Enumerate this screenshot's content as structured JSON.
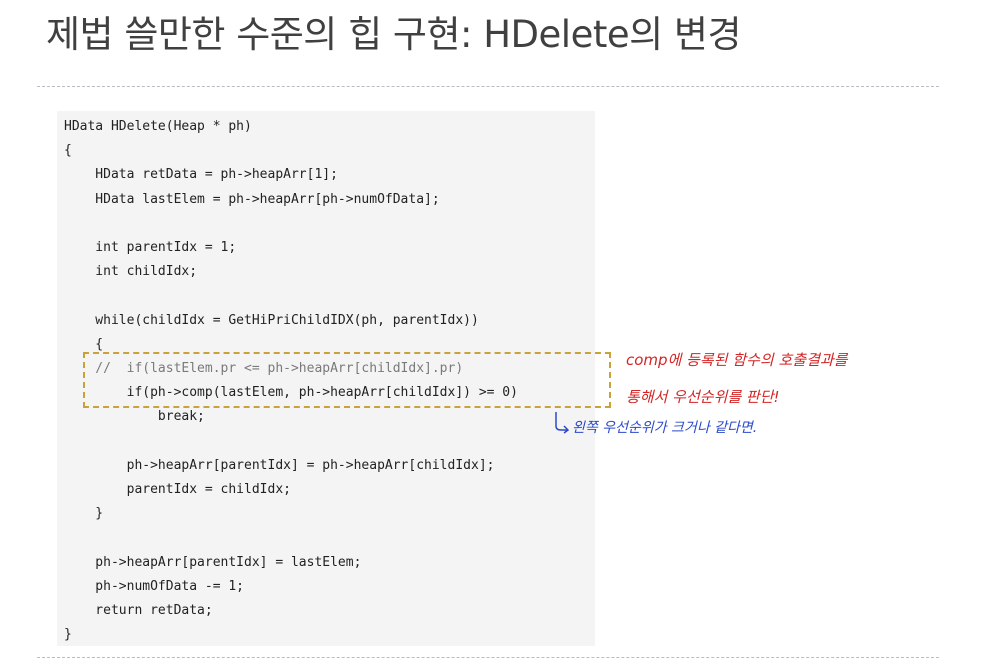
{
  "slide": {
    "title": "제법 쓸만한 수준의 힙 구현: HDelete의 변경"
  },
  "code": {
    "lines": [
      "HData HDelete(Heap * ph)",
      "{",
      "    HData retData = ph->heapArr[1];",
      "    HData lastElem = ph->heapArr[ph->numOfData];",
      "",
      "    int parentIdx = 1;",
      "    int childIdx;",
      "",
      "    while(childIdx = GetHiPriChildIDX(ph, parentIdx))",
      "    {",
      "    //  if(lastElem.pr <= ph->heapArr[childIdx].pr)",
      "        if(ph->comp(lastElem, ph->heapArr[childIdx]) >= 0)",
      "            break;",
      "",
      "        ph->heapArr[parentIdx] = ph->heapArr[childIdx];",
      "        parentIdx = childIdx;",
      "    }",
      "",
      "    ph->heapArr[parentIdx] = lastElem;",
      "    ph->numOfData -= 1;",
      "    return retData;",
      "}"
    ]
  },
  "annotations": {
    "line1": "comp에 등록된 함수의 호출결과를",
    "line2": "통해서 우선순위를 판단!",
    "handwritten": "왼쪽 우선순위가 크거나 같다면."
  },
  "colors": {
    "title": "#404040",
    "annotation": "#d42525",
    "highlight_border": "#c9a33a",
    "handwritten": "#2c49c9",
    "code_background": "#f4f4f4"
  }
}
